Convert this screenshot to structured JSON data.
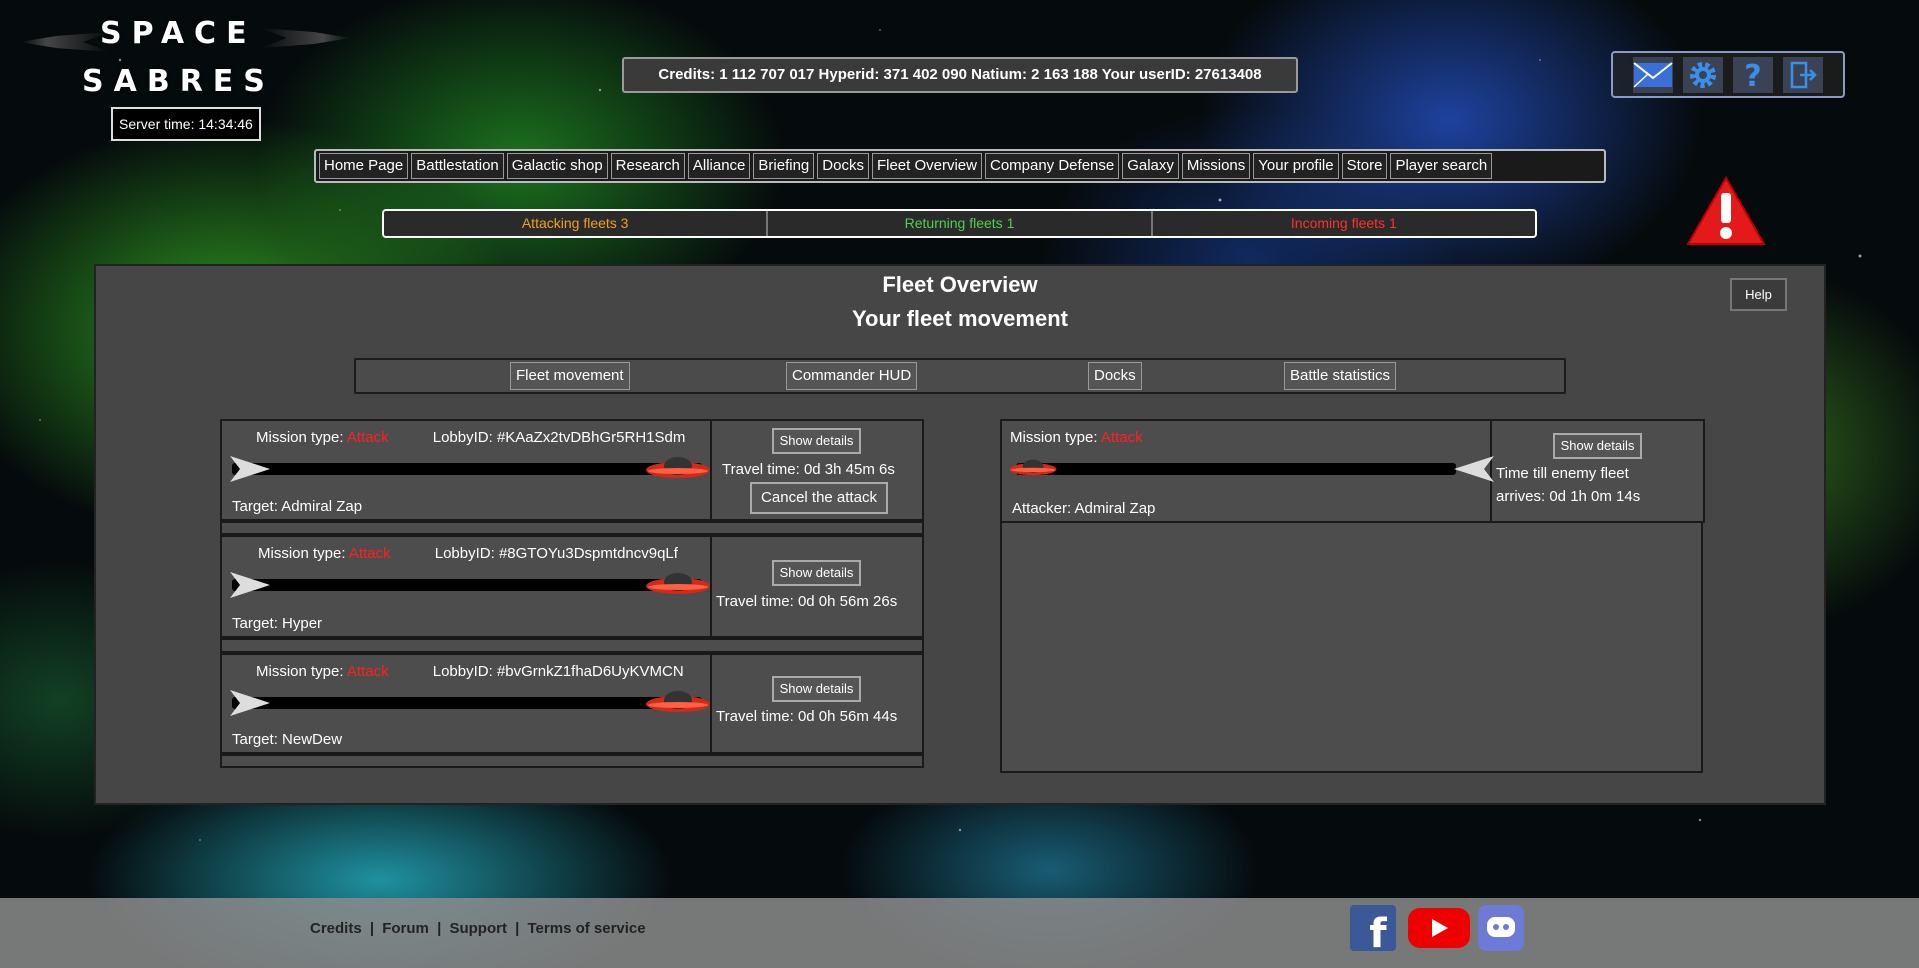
{
  "logo": {
    "line1": "SPACE",
    "line2": "SABRES"
  },
  "server_time": "Server time: 14:34:46",
  "resources": "Credits: 1 112 707 017 Hyperid: 371 402 090 Natium: 2 163 188 Your userID: 27613408",
  "top_icons": [
    "mail-icon",
    "settings-icon",
    "help-icon",
    "logout-icon"
  ],
  "nav": [
    "Home Page",
    "Battlestation",
    "Galactic shop",
    "Research",
    "Alliance",
    "Briefing",
    "Docks",
    "Fleet Overview",
    "Company Defense",
    "Galaxy",
    "Missions",
    "Your profile",
    "Store",
    "Player search"
  ],
  "fleet_status": {
    "attacking": "Attacking fleets 3",
    "returning": "Returning fleets 1",
    "incoming": "Incoming fleets 1",
    "colors": {
      "attacking": "#f0a020",
      "returning": "#50d050",
      "incoming": "#ff3030"
    }
  },
  "panel": {
    "title": "Fleet Overview",
    "subtitle": "Your fleet movement",
    "help": "Help",
    "tabs": [
      "Fleet movement",
      "Commander HUD",
      "Docks",
      "Battle statistics"
    ]
  },
  "outgoing": [
    {
      "mission_label": "Mission type:",
      "mission_type": "Attack",
      "lobby": "LobbyID: #KAaZx2tvDBhGr5RH1Sdm",
      "target": "Target: Admiral Zap",
      "details": "Show details",
      "travel": "Travel time: 0d 3h 45m 6s",
      "cancel": "Cancel the attack"
    },
    {
      "mission_label": "Mission type:",
      "mission_type": "Attack",
      "lobby": "LobbyID: #8GTOYu3Dspmtdncv9qLf",
      "target": "Target: Hyper",
      "details": "Show details",
      "travel": "Travel time: 0d 0h 56m 26s"
    },
    {
      "mission_label": "Mission type:",
      "mission_type": "Attack",
      "lobby": "LobbyID: #bvGrnkZ1fhaD6UyKVMCN",
      "target": "Target: NewDew",
      "details": "Show details",
      "travel": "Travel time: 0d 0h 56m 44s"
    }
  ],
  "incoming": {
    "mission_label": "Mission type:",
    "mission_type": "Attack",
    "attacker": "Attacker: Admiral Zap",
    "details": "Show details",
    "arrival_line1": "Time till enemy fleet",
    "arrival_line2": "arrives: 0d 1h 0m 14s"
  },
  "footer": {
    "credits": "Credits",
    "forum": "Forum",
    "support": "Support",
    "terms": "Terms of service",
    "separator": "|"
  }
}
